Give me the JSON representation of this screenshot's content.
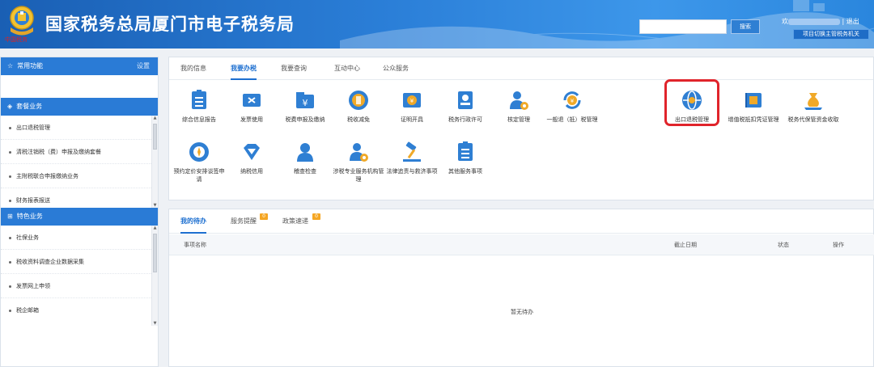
{
  "header": {
    "title": "国家税务总局厦门市电子税务局",
    "seal_text": "中国税务",
    "search_placeholder": "",
    "search_button": "搜索",
    "welcome_prefix": "欢",
    "logout_sep": "|",
    "logout": "退出",
    "switch_button": "项目切换主管税务机关"
  },
  "sidebar": {
    "common": {
      "label": "常用功能",
      "settings": "设置",
      "icon": "star-icon"
    },
    "package": {
      "label": "套餐业务",
      "icon": "cube-icon",
      "items": [
        "出口退税管理",
        "清税注销税（费）申报及缴纳套餐",
        "主附税联合申报缴纳业务",
        "财务报表报送"
      ]
    },
    "special": {
      "label": "特色业务",
      "icon": "grid-icon",
      "items": [
        "社保业务",
        "税收资料调查企业数据采集",
        "发票网上申领",
        "税企邮箱"
      ]
    }
  },
  "top_panel": {
    "tabs": [
      "我的信息",
      "我要办税",
      "我要查询",
      "互动中心",
      "公众服务"
    ],
    "active_tab": 1,
    "row1": [
      {
        "label": "综合信息报告",
        "icon": "report-icon",
        "color": "#2f7fd3"
      },
      {
        "label": "发票使用",
        "icon": "ticket-icon",
        "color": "#2f7fd3"
      },
      {
        "label": "税费申报及缴纳",
        "icon": "yuan-folder-icon",
        "color": "#2f7fd3"
      },
      {
        "label": "税收减免",
        "icon": "coin-reduce-icon",
        "color": "#e89a1c"
      },
      {
        "label": "证明开具",
        "icon": "certificate-icon",
        "color": "#e89a1c"
      },
      {
        "label": "税务行政许可",
        "icon": "id-card-icon",
        "color": "#2f7fd3"
      },
      {
        "label": "核定管理",
        "icon": "person-gear-icon",
        "color": "#2f7fd3"
      },
      {
        "label": "一般退（抵）税管理",
        "icon": "refund-cycle-icon",
        "color": "#e89a1c"
      },
      {
        "label": "出口退税管理",
        "icon": "globe-icon",
        "color": "#2f7fd3"
      },
      {
        "label": "增值税抵扣凭证管理",
        "icon": "voucher-icon",
        "color": "#2f7fd3"
      },
      {
        "label": "税务代保管资金收取",
        "icon": "money-bag-icon",
        "color": "#e89a1c"
      }
    ],
    "row2": [
      {
        "label": "预约定价安排谈签申请",
        "icon": "compass-icon",
        "color": "#2f7fd3"
      },
      {
        "label": "纳税信用",
        "icon": "diamond-icon",
        "color": "#2f7fd3"
      },
      {
        "label": "稽查检查",
        "icon": "inspector-icon",
        "color": "#2f7fd3"
      },
      {
        "label": "涉税专业服务机构管理",
        "icon": "agency-gear-icon",
        "color": "#2f7fd3"
      },
      {
        "label": "法律追责与救济事项",
        "icon": "gavel-icon",
        "color": "#e89a1c"
      },
      {
        "label": "其他服务事项",
        "icon": "list-doc-icon",
        "color": "#2f7fd3"
      }
    ]
  },
  "bottom_panel": {
    "tabs": [
      {
        "label": "我的待办",
        "badge": ""
      },
      {
        "label": "服务提醒",
        "badge": "0"
      },
      {
        "label": "政策速递",
        "badge": "0"
      }
    ],
    "active_tab": 0,
    "columns": [
      "事项名称",
      "截止日期",
      "状态",
      "操作"
    ],
    "empty_text": "暂无待办"
  },
  "colors": {
    "header_blue": "#2a7bd6",
    "accent": "#1d6fd0",
    "highlight_red": "#e0242b",
    "badge_orange": "#f5a623"
  }
}
